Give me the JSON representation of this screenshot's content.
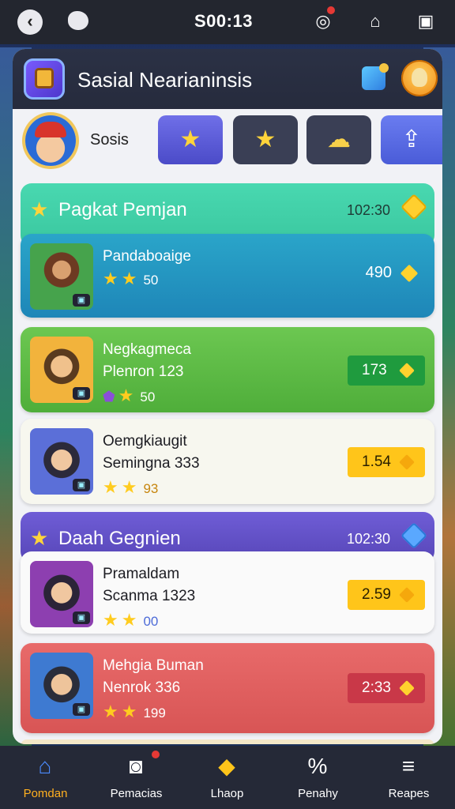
{
  "status_bar": {
    "time": "S00:13"
  },
  "header": {
    "title": "Sasial Nearianinsis"
  },
  "social": {
    "label": "Sosis"
  },
  "sections": [
    {
      "title": "Pagkat Pemjan",
      "time": "102:30"
    },
    {
      "title": "Daah Gegnien",
      "time": "102:30"
    }
  ],
  "items": [
    {
      "name": "Pandaboaige",
      "sub": "",
      "rating": "50",
      "price": "490"
    },
    {
      "name": "Negkagmeca",
      "sub": "Plenron 123",
      "rating": "50",
      "price": "173"
    },
    {
      "name": "Oemgkiaugit",
      "sub": "Semingna 333",
      "rating": "93",
      "price": "1.54"
    },
    {
      "name": "Pramaldam",
      "sub": "Scanma 1323",
      "rating": "00",
      "price": "2.59"
    },
    {
      "name": "Mehgia Buman",
      "sub": "Nenrok 336",
      "rating": "199",
      "price": "2:33"
    }
  ],
  "nav": [
    {
      "label": "Pomdan"
    },
    {
      "label": "Pemacias"
    },
    {
      "label": "Lhaop"
    },
    {
      "label": "Penahy"
    },
    {
      "label": "Reapes"
    }
  ],
  "colors": {
    "accent_orange": "#ffb020",
    "section1": "#3ac79f",
    "section2": "#5746b8",
    "gold": "#ffc51a"
  }
}
